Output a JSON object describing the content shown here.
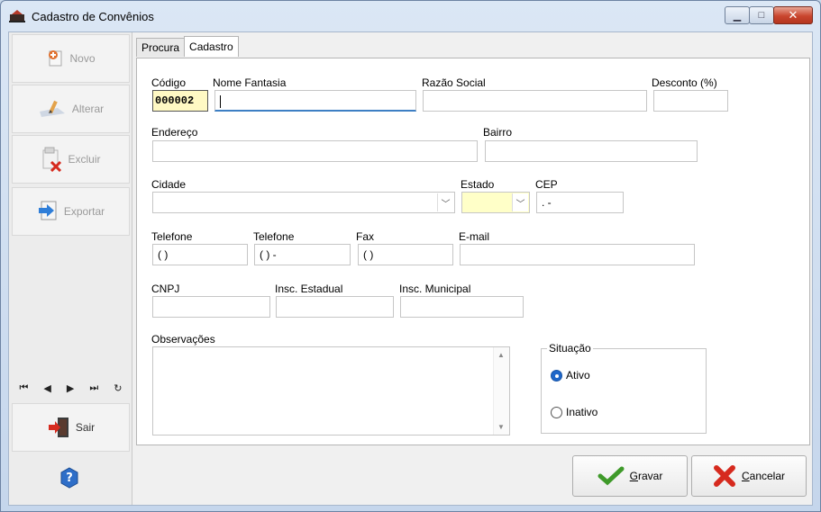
{
  "window": {
    "title": "Cadastro de Convênios",
    "min": "▁",
    "max": "□",
    "close": "✕"
  },
  "sidebar": {
    "novo": "Novo",
    "alterar": "Alterar",
    "excluir": "Excluir",
    "exportar": "Exportar",
    "nav": {
      "first": "⏮",
      "prev": "◀",
      "next": "▶",
      "last": "⏭",
      "refresh": "↻"
    },
    "sair": "Sair"
  },
  "tabs": [
    {
      "label": "Procura"
    },
    {
      "label": "Cadastro"
    }
  ],
  "form": {
    "codigo_label": "Código",
    "codigo_value": "000002",
    "nome_fantasia_label": "Nome Fantasia",
    "razao_social_label": "Razão Social",
    "desconto_label": "Desconto (%)",
    "endereco_label": "Endereço",
    "bairro_label": "Bairro",
    "cidade_label": "Cidade",
    "estado_label": "Estado",
    "cep_label": "CEP",
    "cep_value": " .  -",
    "telefone1_label": "Telefone",
    "telefone1_value": "( )",
    "telefone2_label": "Telefone",
    "telefone2_value": "( )   -",
    "fax_label": "Fax",
    "fax_value": "( )",
    "email_label": "E-mail",
    "cnpj_label": "CNPJ",
    "insc_estadual_label": "Insc. Estadual",
    "insc_municipal_label": "Insc. Municipal",
    "observacoes_label": "Observações",
    "situacao_label": "Situação",
    "ativo_label": "Ativo",
    "inativo_label": "Inativo",
    "situacao_selected": "Ativo"
  },
  "actions": {
    "gravar_rest": "ravar",
    "gravar_access": "G",
    "cancelar_rest": "ancelar",
    "cancelar_access": "C"
  },
  "colors": {
    "accent": "#1f67c9",
    "code_bg": "#fff9c4",
    "estado_bg": "#ffffc8"
  }
}
